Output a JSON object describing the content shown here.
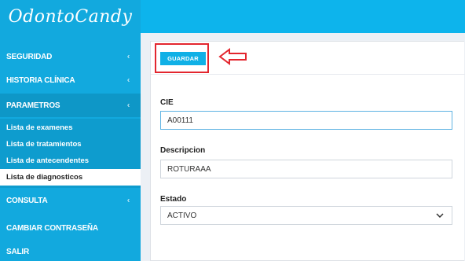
{
  "app": {
    "logo": "OdontoCandy"
  },
  "sidebar": {
    "items": [
      {
        "label": "SEGURIDAD",
        "chevron": "‹"
      },
      {
        "label": "HISTORIA CLÍNICA",
        "chevron": "‹"
      },
      {
        "label": "PARAMETROS",
        "chevron": "‹"
      },
      {
        "label": "CONSULTA",
        "chevron": "‹"
      },
      {
        "label": "CAMBIAR CONTRASEÑA"
      },
      {
        "label": "SALIR"
      }
    ],
    "submenu": [
      {
        "label": "Lista de examenes"
      },
      {
        "label": "Lista de tratamientos"
      },
      {
        "label": "Lista de antecendentes"
      },
      {
        "label": "Lista de diagnosticos",
        "selected": true
      }
    ]
  },
  "form": {
    "save_label": "GUARDAR",
    "cie": {
      "label": "CIE",
      "value": "A00111"
    },
    "descripcion": {
      "label": "Descripcion",
      "value": "ROTURAAA"
    },
    "estado": {
      "label": "Estado",
      "value": "ACTIVO"
    }
  },
  "colors": {
    "brand": "#0db4ec",
    "sidebar": "#12a9de",
    "highlight": "#e3262e"
  },
  "icons": {
    "arrow": "left-arrow-outline-icon",
    "select": "chevron-down-icon"
  }
}
